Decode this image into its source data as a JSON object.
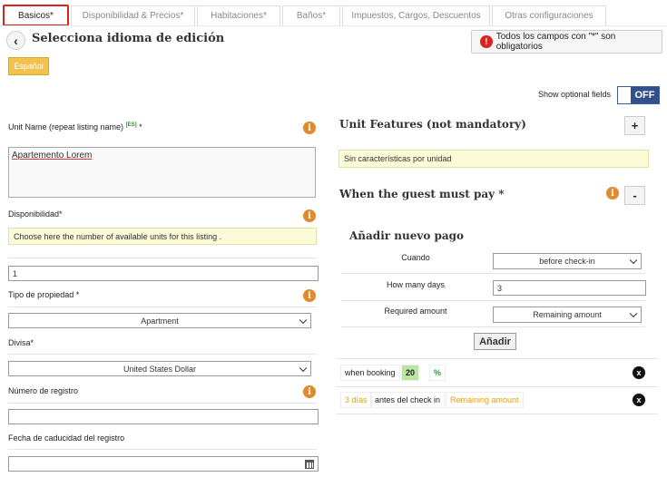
{
  "tabs": [
    {
      "label": "Basicos*",
      "active": true
    },
    {
      "label": "Disponibilidad & Precios*"
    },
    {
      "label": "Habitaciones*"
    },
    {
      "label": "Baños*"
    },
    {
      "label": "Impuestos, Cargos, Descuentos"
    },
    {
      "label": "Otras configuraciones"
    }
  ],
  "header": {
    "title": "Selecciona idioma de edición",
    "required_notice": "Todos los campos con \"*\" son obligatorios",
    "language": "Español"
  },
  "optional": {
    "label": "Show optional fields",
    "state": "OFF"
  },
  "form": {
    "unit_name": {
      "label": "Unit Name (repeat listing name)",
      "lang_tag": "[ES]",
      "required_mark": "*",
      "value": "Apartemento Lorem"
    },
    "availability": {
      "label": "Disponibilidad*",
      "hint": "Choose here the number of available units for this listing .",
      "value": "1"
    },
    "property_type": {
      "label": "Tipo de propiedad *",
      "value": "Apartment"
    },
    "currency": {
      "label": "Divisa*",
      "value": "United States Dollar"
    },
    "registration": {
      "label": "Número de registro",
      "value": ""
    },
    "registration_expiry": {
      "label": "Fecha de caducidad del registro",
      "value": ""
    }
  },
  "features": {
    "title": "Unit Features (not mandatory)",
    "add_label": "+",
    "empty_text": "Sin características por unidad"
  },
  "payment": {
    "title": "When the guest must pay *",
    "remove_label": "-",
    "new_title": "Añadir nuevo pago",
    "when_label": "Cuando",
    "when_value": "before check-in",
    "days_label": "How many days",
    "days_value": "3",
    "amount_label": "Required amount",
    "amount_value": "Remaining amount",
    "add_button": "Añadir",
    "rows": [
      {
        "a": "when booking",
        "b": "20",
        "c": "%"
      },
      {
        "a": "3 días",
        "b": "antes del check in",
        "c": "Remaining amount"
      }
    ],
    "remove_icon": "x"
  },
  "icons": {
    "info": "i",
    "alert": "!",
    "back": "‹"
  },
  "colors": {
    "accent": "#f3c24c",
    "active_tab_border": "#dd2222",
    "toggle": "#34508a",
    "info": "#e08a2c",
    "hint_bg": "#fbfbd8"
  }
}
